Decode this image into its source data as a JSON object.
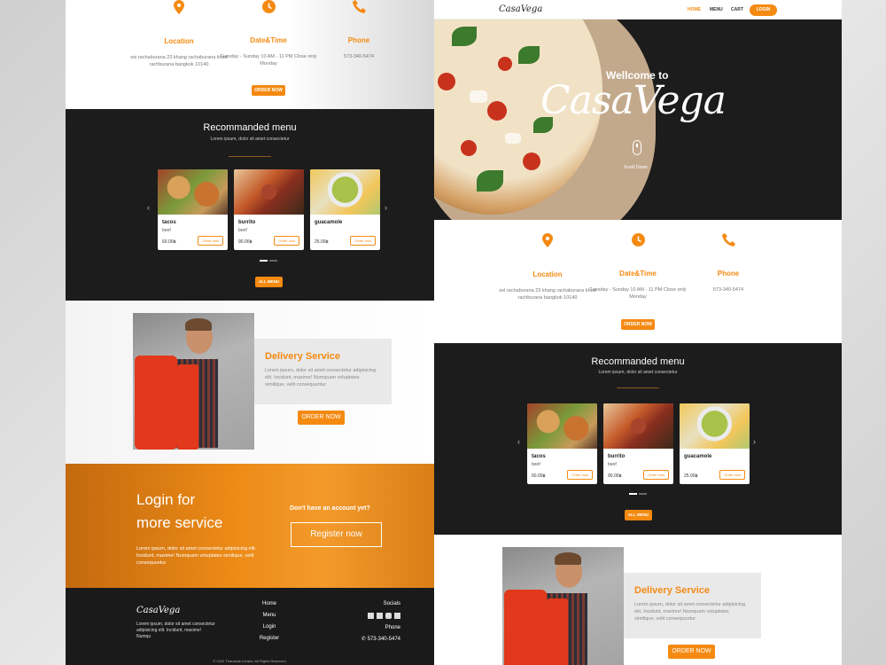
{
  "brand": {
    "logo": "CasaVega",
    "accent": "#f48a12"
  },
  "nav": {
    "home": "HOME",
    "menu": "MENU",
    "cart": "CART",
    "login": "LOGIN"
  },
  "hero": {
    "welcome": "Wellcome to",
    "title": "CasaVega",
    "scroll": "Scroll Down"
  },
  "info": {
    "location": {
      "title": "Location",
      "text": "soi rachaburana 23 khang rachaburana khed rachburana bangkok 10140"
    },
    "datetime": {
      "title": "Date&Time",
      "text": "Tuesday - Sunday 10 AM - 11 PM Close only Monday"
    },
    "phone": {
      "title": "Phone",
      "text": "573-340-5474"
    },
    "order_button": "ORDER NOW"
  },
  "menu": {
    "title": "Recommanded menu",
    "subtitle": "Lorem ipsum, dolor sit amet consectetur",
    "items": [
      {
        "name": "tacos",
        "desc": "beef",
        "price": "60.00฿",
        "button": "Order now"
      },
      {
        "name": "burrito",
        "desc": "beef",
        "price": "90.00฿",
        "button": "Order now"
      },
      {
        "name": "guacamole",
        "desc": "",
        "price": "25.00฿",
        "button": "Order now"
      }
    ],
    "all_button": "ALL MENU"
  },
  "delivery": {
    "title": "Delivery Service",
    "text": "Lorem ipsum, dolor sit amet consectetur adipisicing elit. Incidunt, maxime! Numquam voluptates similique, velit consequuntur",
    "button": "ORDER NOW"
  },
  "login_section": {
    "title_line1": "Login for",
    "title_line2": "more service",
    "text": "Lorem ipsum, dolor sit amet consectetur adipisicing elit. Incidunt, maxime! Numquam voluptates similique, velit consequuntur",
    "question": "Don't have an account yet?",
    "register": "Register now"
  },
  "footer": {
    "logo": "CasaVega",
    "text": "Lorem ipsum, dolor sit amet consectetur adipisicing elit. Incidunt, maxime! Numqu",
    "links": [
      "Home",
      "Menu",
      "Login",
      "Register"
    ],
    "socials": "Socials",
    "phone_label": "Phone",
    "phone": "573-340-5474",
    "copyright": "© 2022 Thanasak Limsiia. All Rights Reserved."
  }
}
